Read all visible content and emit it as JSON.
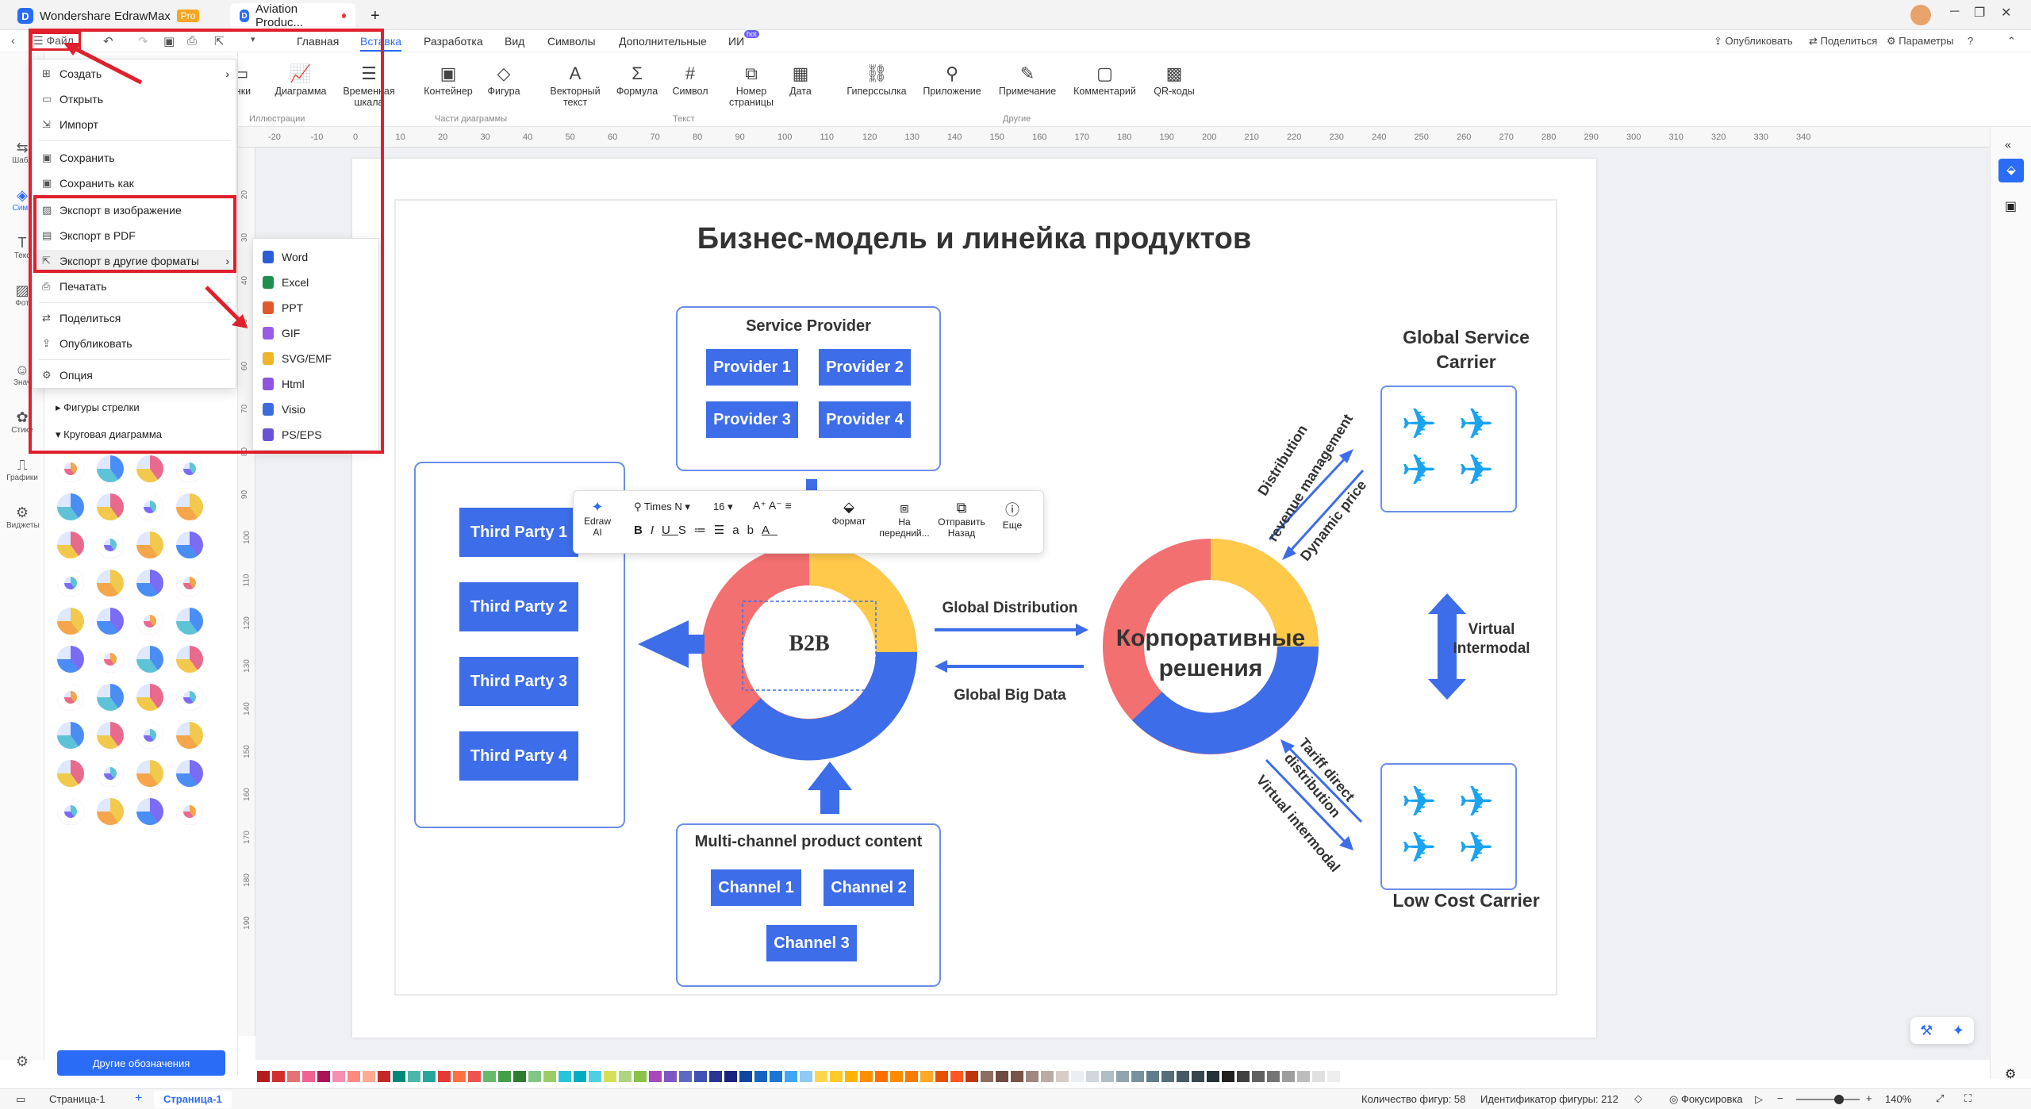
{
  "titlebar": {
    "app_tab": "Wondershare EdrawMax",
    "pro_badge": "Pro",
    "doc_tab": "Aviation Produc...",
    "new_tab": "+"
  },
  "menubar": {
    "file": "Файл",
    "tabs": [
      "Главная",
      "Вставка",
      "Разработка",
      "Вид",
      "Символы",
      "Дополнительные",
      "ИИ"
    ],
    "ai_badge": "hot",
    "publish": "Опубликовать",
    "share": "Поделиться",
    "params": "Параметры"
  },
  "ribbon": {
    "buttons": [
      "инки",
      "Диаграмма",
      "Временная шкала",
      "Контейнер",
      "Фигура",
      "Векторный текст",
      "Формула",
      "Символ",
      "Номер страницы",
      "Дата",
      "Гиперссылка",
      "Приложение",
      "Примечание",
      "Комментарий",
      "QR-коды"
    ],
    "groups": [
      "Иллюстрации",
      "Части диаграммы",
      "Текст",
      "Другие"
    ]
  },
  "ruler": [
    "-20",
    "-10",
    "0",
    "10",
    "20",
    "30",
    "40",
    "50",
    "60",
    "70",
    "80",
    "90",
    "100",
    "110",
    "120",
    "130",
    "140",
    "150",
    "160",
    "170",
    "180",
    "190",
    "200",
    "210",
    "220",
    "230",
    "240",
    "250",
    "260",
    "270",
    "280",
    "290",
    "300",
    "310",
    "320",
    "330",
    "340"
  ],
  "vruler": [
    "20",
    "30",
    "40",
    "50",
    "60",
    "70",
    "80",
    "90",
    "100",
    "110",
    "120",
    "130",
    "140",
    "150",
    "160",
    "170",
    "180",
    "190"
  ],
  "leftrail": [
    "Шабл",
    "Симв",
    "Текс",
    "Фот",
    "Знач",
    "Стике",
    "Графики",
    "Виджеты"
  ],
  "shapepanel": {
    "cat1": "Фигуры стрелки",
    "cat2": "Круговая диаграмма",
    "more_button": "Другие обозначения"
  },
  "file_menu": {
    "items": [
      "Создать",
      "Открыть",
      "Импорт",
      "Сохранить",
      "Сохранить как",
      "Экспорт в изображение",
      "Экспорт в PDF",
      "Экспорт в другие форматы",
      "Печатать",
      "Поделиться",
      "Опубликовать",
      "Опция"
    ]
  },
  "export_submenu": {
    "items": [
      "Word",
      "Excel",
      "PPT",
      "GIF",
      "SVG/EMF",
      "Html",
      "Visio",
      "PS/EPS"
    ]
  },
  "float_toolbar": {
    "ai": "Edraw AI",
    "font": "Times N",
    "size": "16",
    "format": "Формат",
    "front": "На передний...",
    "back": "Отправить Назад",
    "more": "Еще"
  },
  "diagram": {
    "title": "Бизнес-модель и линейка продуктов",
    "provider_title": "Service Provider",
    "providers": [
      "Provider 1",
      "Provider 2",
      "Provider 3",
      "Provider 4"
    ],
    "third_parties": [
      "Third Party 1",
      "Third Party 2",
      "Third Party 3",
      "Third Party 4"
    ],
    "channel_title": "Multi-channel product content",
    "channels": [
      "Channel 1",
      "Channel 2",
      "Channel 3"
    ],
    "b2b": "B2B",
    "corp_line1": "Корпоративные",
    "corp_line2": "решения",
    "global_distribution": "Global Distribution",
    "global_big_data": "Global Big Data",
    "global_service": "Global Service Carrier",
    "low_cost": "Low Cost Carrier",
    "distribution": "Distribution",
    "revenue": "revenue management",
    "dynamic_price": "Dynamic price",
    "virtual_intermodal_right": "Virtual Intermodal",
    "tariff": "Tariff direct",
    "distribution2": "distribution",
    "virtual_intermodal_diag": "Virtual intermodal",
    "colors": {
      "blue": "#3d6de8",
      "red": "#f37070",
      "yellow": "#ffc94a",
      "plane": "#1aa3f0"
    }
  },
  "statusbar": {
    "page_tab": "Страница-1",
    "page_tab_active": "Страница-1",
    "shape_count": "Количество фигур: 58",
    "shape_id": "Идентификатор фигуры: 212",
    "focus": "Фокусировка",
    "zoom": "140%"
  }
}
